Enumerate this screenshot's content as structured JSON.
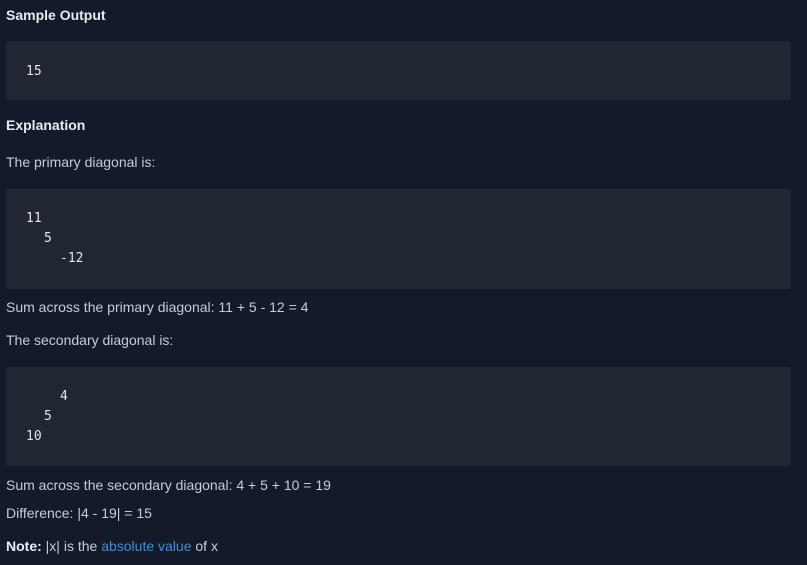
{
  "sample_output": {
    "heading": "Sample Output",
    "code": "15"
  },
  "explanation": {
    "heading": "Explanation",
    "primary_intro": "The primary diagonal is:",
    "primary_lines": [
      "11",
      "5",
      "-12"
    ],
    "primary_sum": "Sum across the primary diagonal: 11 + 5 - 12 = 4",
    "secondary_intro": "The secondary diagonal is:",
    "secondary_lines": [
      "4",
      "5",
      "10"
    ],
    "secondary_sum": "Sum across the secondary diagonal: 4 + 5 + 10 = 19",
    "difference": "Difference: |4 - 19| = 15"
  },
  "note": {
    "label": "Note:",
    "text_before": " |x| is the ",
    "link_text": "absolute value",
    "text_after": " of x"
  },
  "colors": {
    "background": "#141a29",
    "code_background": "#212633",
    "link": "#3e8fd6"
  }
}
